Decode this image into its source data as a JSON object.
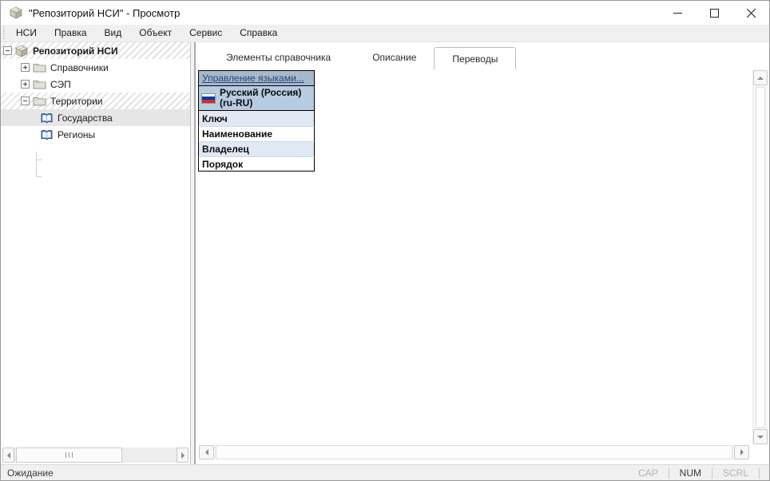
{
  "window": {
    "title": "\"Репозиторий НСИ\" - Просмотр"
  },
  "menu": {
    "items": [
      "НСИ",
      "Правка",
      "Вид",
      "Объект",
      "Сервис",
      "Справка"
    ]
  },
  "tree": {
    "items": [
      {
        "label": "Репозиторий НСИ",
        "depth": 0,
        "expander": "collapse",
        "icon": "repository-icon",
        "row_style": "hatched"
      },
      {
        "label": "Справочники",
        "depth": 1,
        "expander": "expand",
        "icon": "folder-icon",
        "row_style": "normal"
      },
      {
        "label": "СЭП",
        "depth": 1,
        "expander": "expand",
        "icon": "folder-icon",
        "row_style": "normal"
      },
      {
        "label": "Территории",
        "depth": 1,
        "expander": "collapse",
        "icon": "folder-icon",
        "row_style": "hatched"
      },
      {
        "label": "Государства",
        "depth": 2,
        "expander": "none",
        "icon": "book-icon",
        "row_style": "selected"
      },
      {
        "label": "Регионы",
        "depth": 2,
        "expander": "none",
        "icon": "book-icon",
        "row_style": "normal"
      }
    ]
  },
  "tabs": [
    {
      "label": "Элементы справочника",
      "active": false
    },
    {
      "label": "Описание",
      "active": false
    },
    {
      "label": "Переводы",
      "active": true
    }
  ],
  "translations": {
    "manage_languages_link": "Управление языками...",
    "language_column": {
      "flag": "flag-russia-icon",
      "name": "Русский (Россия)",
      "code": "(ru-RU)"
    },
    "field_rows": [
      "Ключ",
      "Наименование",
      "Владелец",
      "Порядок"
    ]
  },
  "status": {
    "text": "Ожидание",
    "indicators": [
      {
        "label": "CAP",
        "active": false
      },
      {
        "label": "NUM",
        "active": true
      },
      {
        "label": "SCRL",
        "active": false
      }
    ]
  },
  "colors": {
    "link_header_bg": "#a6b8cd",
    "language_row_bg": "#b7cbe1",
    "alt_row_bg": "#dfe8f3",
    "link_text": "#24466e",
    "tree_selection_bg": "#e6e6e6",
    "flag_blue": "#0039a6",
    "flag_red": "#d52b1e"
  }
}
